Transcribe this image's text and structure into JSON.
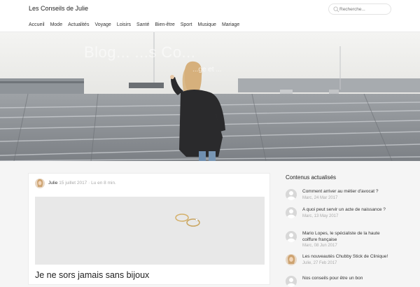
{
  "header": {
    "site_title": "Les Conseils de Julie",
    "search_placeholder": "Recherche..."
  },
  "nav": [
    "Accueil",
    "Mode",
    "Actualités",
    "Voyage",
    "Loisirs",
    "Santé",
    "Bien-être",
    "Sport",
    "Musique",
    "Mariage"
  ],
  "hero": {
    "title": "Blog... ...s Co...",
    "subtitle": "...ge et ..."
  },
  "article": {
    "author": "Julie",
    "date": "15 juillet 2017",
    "read_time": "· Lu en 8 min.",
    "title": "Je ne sors jamais sans bijoux"
  },
  "sidebar": {
    "title": "Contenus actualisés",
    "items": [
      {
        "text": "Comment arriver au métier d'avocat ?",
        "date": "Marc, 24 Mar 2017",
        "avatar": "generic"
      },
      {
        "text": "A quoi peut servir un acte de naissance ?",
        "date": "Marc, 13 May 2017",
        "avatar": "generic"
      },
      {
        "text": "Mario Lopes, le spécialiste de la haute coiffure française",
        "date": "Marc, 08 Jun 2017",
        "avatar": "generic"
      },
      {
        "text": "Les nouveautés Chubby Stick de Clinique!",
        "date": "Julie, 27 Feb 2017",
        "avatar": "julie"
      },
      {
        "text": "Nos conseils pour être un bon",
        "date": "",
        "avatar": "generic"
      }
    ]
  },
  "colors": {
    "accent": "#333333",
    "muted": "#aaaaaa",
    "background": "#f5f5f5"
  }
}
